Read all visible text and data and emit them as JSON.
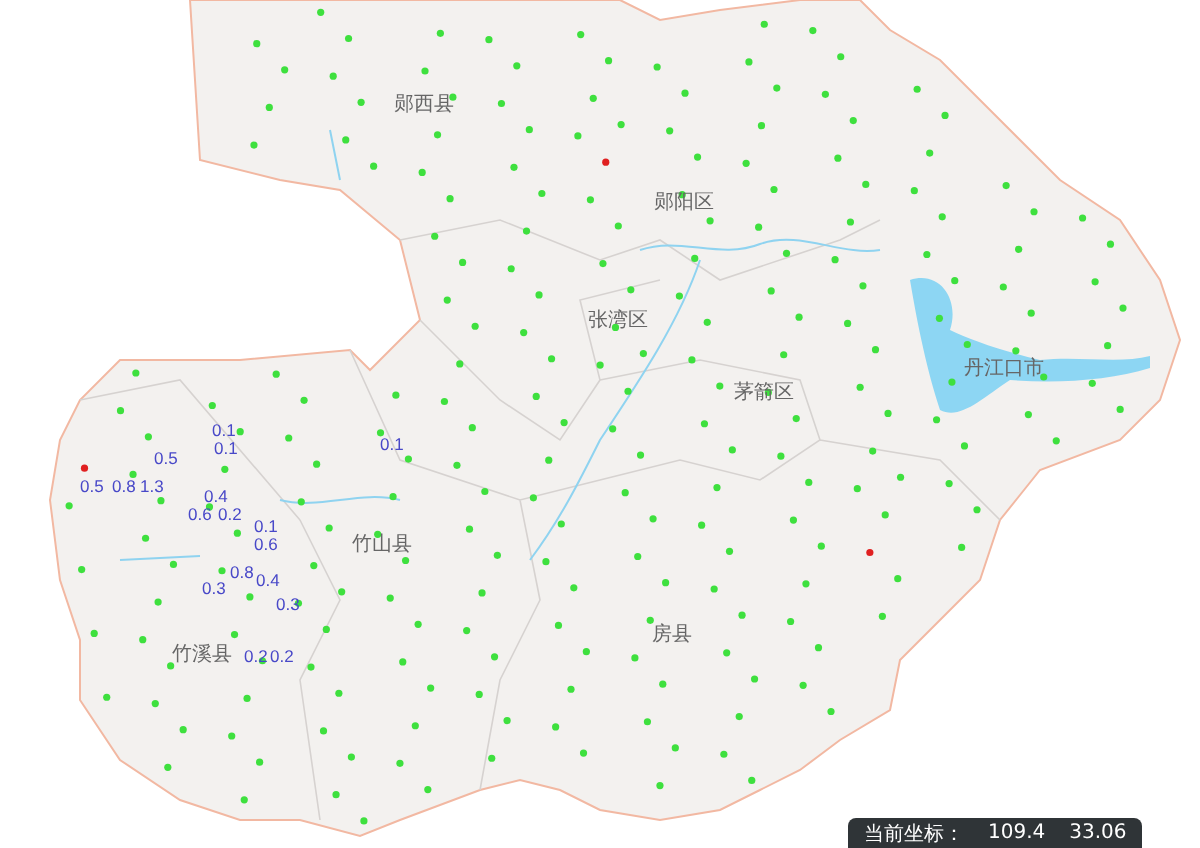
{
  "map": {
    "place_labels": [
      "郧西县",
      "郧阳区",
      "张湾区",
      "茅箭区",
      "丹江口市",
      "竹山县",
      "竹溪县",
      "房县"
    ],
    "value_labels": [
      "0.1",
      "0.1",
      "0.1",
      "0.5",
      "0.5",
      "0.8",
      "1.3",
      "0.4",
      "0.6",
      "0.2",
      "0.1",
      "0.6",
      "0.8",
      "0.3",
      "0.4",
      "0.3",
      "0.2",
      "0.2"
    ],
    "coordinate_readout": {
      "label": "当前坐标：",
      "longitude": "109.4",
      "latitude": "33.06"
    }
  }
}
